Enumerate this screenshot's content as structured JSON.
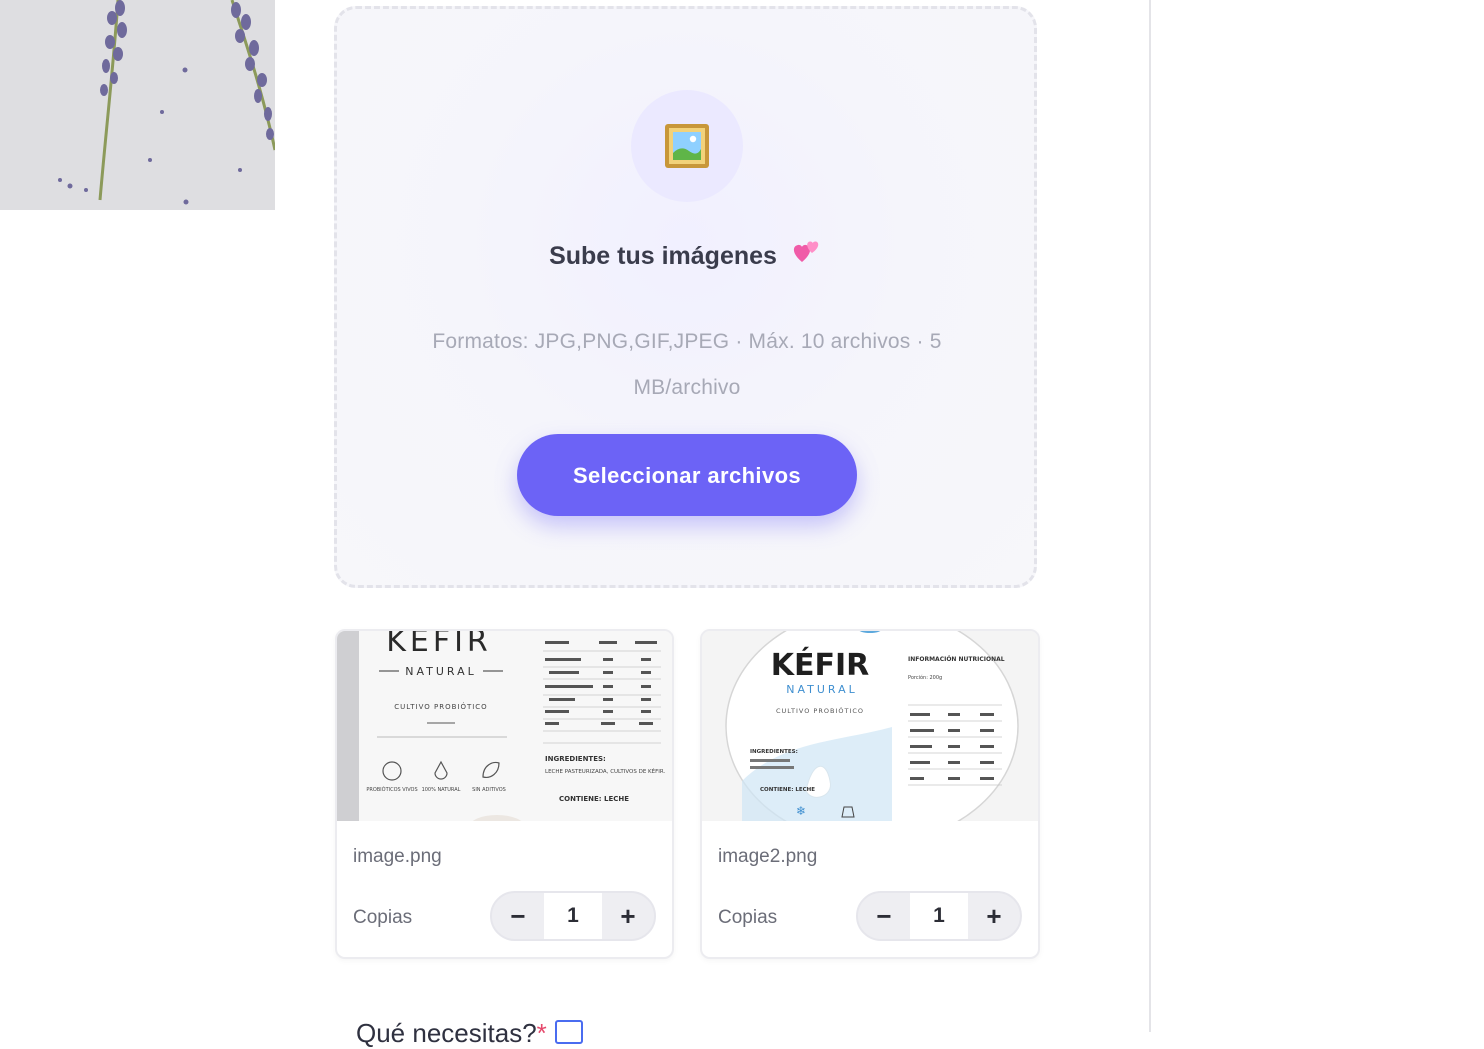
{
  "upload": {
    "title": "Sube tus imágenes",
    "formats": "Formatos: JPG,PNG,GIF,JPEG · Máx. 10 archivos · 5 MB/archivo",
    "button_label": "Seleccionar archivos",
    "icon": "framed-picture-icon",
    "title_icon": "two-hearts-icon"
  },
  "files": [
    {
      "name": "image.png",
      "copies_label": "Copias",
      "copies": "1",
      "thumb": {
        "brand": "KÉFIR",
        "sub": "NATURAL",
        "tagline": "CULTIVO PROBIÓTICO",
        "ingredients_title": "INGREDIENTES:",
        "ingredients": "LECHE PASTEURIZADA, CULTIVOS DE KÉFIR.",
        "contains": "CONTIENE: LECHE",
        "badges": [
          "PROBIÓTICOS VIVOS",
          "100% NATURAL",
          "SIN ADITIVOS"
        ]
      }
    },
    {
      "name": "image2.png",
      "copies_label": "Copias",
      "copies": "1",
      "thumb": {
        "brand": "KÉFIR",
        "sub": "NATURAL",
        "tagline": "CULTIVO PROBIÓTICO",
        "info_title": "INFORMACIÓN NUTRICIONAL",
        "portion": "Porción: 200g",
        "ingredients_title": "INGREDIENTES:",
        "contains": "CONTIENE: LECHE"
      }
    }
  ],
  "decrement_symbol": "−",
  "increment_symbol": "+",
  "next_section": {
    "heading": "Qué necesitas?",
    "required_mark": "*"
  },
  "colors": {
    "accent": "#6c63f6",
    "upload_bg": "#f5f5fb",
    "required": "#e5486b"
  }
}
